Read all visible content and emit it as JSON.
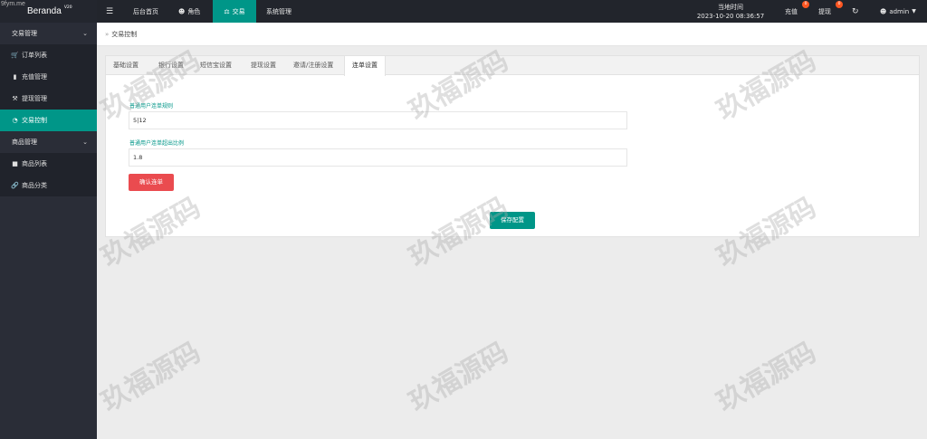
{
  "site_mark": "9fym.me",
  "brand": {
    "name": "Beranda",
    "version": "V20"
  },
  "sidebar": {
    "groups": [
      {
        "label": "交易管理",
        "items": [
          {
            "label": "订单列表",
            "icon": "cart-icon"
          },
          {
            "label": "充值管理",
            "icon": "chat-icon"
          },
          {
            "label": "提现管理",
            "icon": "hammer-icon"
          },
          {
            "label": "交易控制",
            "icon": "gauge-icon",
            "active": true
          }
        ]
      },
      {
        "label": "商品管理",
        "items": [
          {
            "label": "商品列表",
            "icon": "truck-icon"
          },
          {
            "label": "商品分类",
            "icon": "link-icon"
          }
        ]
      }
    ]
  },
  "topbar": {
    "menu_icon": "hamburger-icon",
    "nav": [
      "后台首页",
      "角色",
      "交易",
      "系统管理"
    ],
    "active_nav": "交易",
    "local_time_label": "当地时间",
    "local_time": "2023-10-20 08:36:57",
    "recharge": "充值",
    "recharge_count": "0",
    "withdraw": "提现",
    "withdraw_count": "0",
    "user": "admin"
  },
  "breadcrumb": {
    "current": "交易控制"
  },
  "tabs": [
    "基础设置",
    "银行设置",
    "短信宝设置",
    "提现设置",
    "邀请/注册设置",
    "连单设置"
  ],
  "active_tab": "连单设置",
  "form": {
    "rule_label": "普通用户连单规则",
    "rule_value": "5|12",
    "ratio_label": "普通用户连单超出比例",
    "ratio_value": "1.8",
    "confirm_button": "确认连单",
    "save_button": "保存配置"
  },
  "watermark": "玖福源码",
  "colors": {
    "accent": "#009688",
    "danger": "#ea4b4f",
    "sidebar": "#2a2d37",
    "badge": "#ff5722"
  }
}
